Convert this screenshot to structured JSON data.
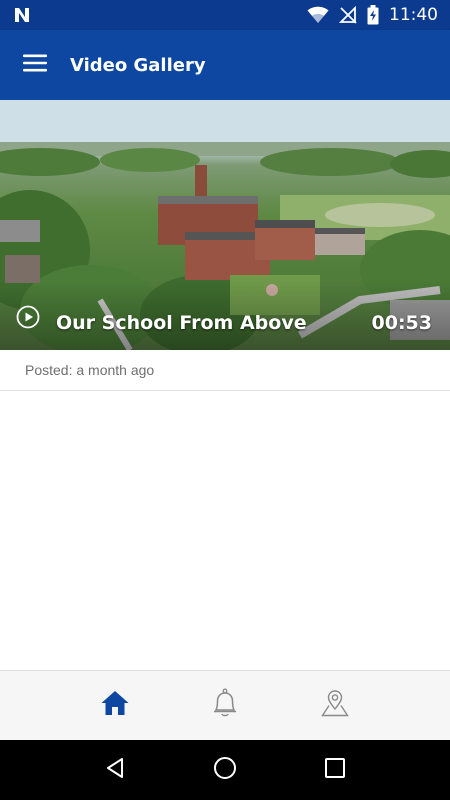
{
  "status_bar": {
    "time": "11:40",
    "icons": [
      "n-logo-icon",
      "wifi-icon",
      "no-signal-icon",
      "battery-charging-icon"
    ]
  },
  "app_bar": {
    "title": "Video Gallery",
    "menu_icon": "hamburger-icon",
    "color": "#0d47a1"
  },
  "videos": [
    {
      "title": "Our School From Above",
      "duration": "00:53",
      "posted": "Posted: a month ago"
    }
  ],
  "bottom_nav": {
    "items": [
      {
        "name": "home",
        "icon": "home-icon",
        "active": true
      },
      {
        "name": "notifications",
        "icon": "bell-icon",
        "active": false
      },
      {
        "name": "location",
        "icon": "map-pin-icon",
        "active": false
      }
    ],
    "active_color": "#0d47a1",
    "inactive_color": "#8a8a8a"
  },
  "system_nav": {
    "buttons": [
      "back-icon",
      "home-circle-icon",
      "recents-icon"
    ]
  }
}
